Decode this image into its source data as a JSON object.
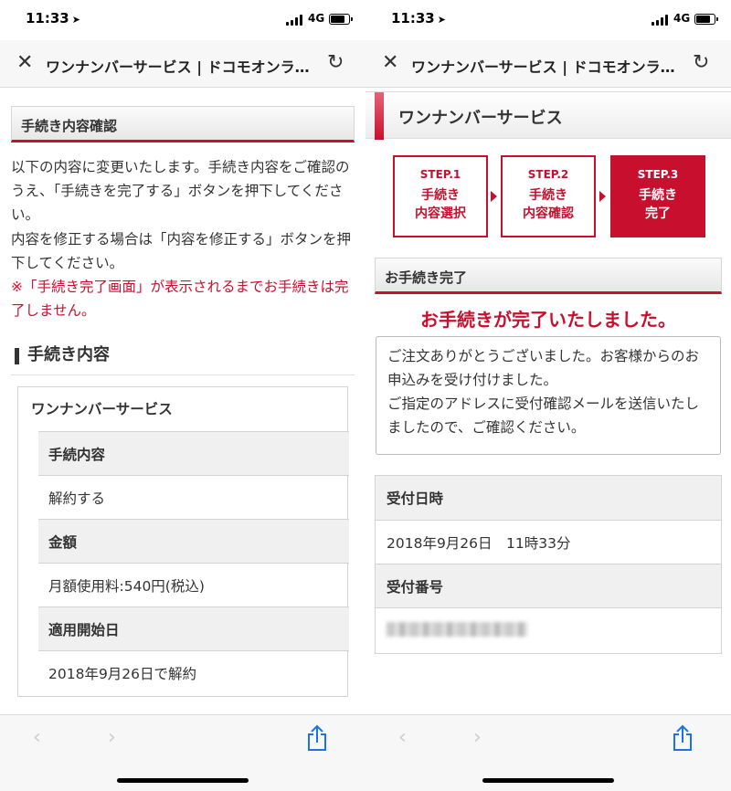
{
  "status_bar": {
    "time": "11:33",
    "location_arrow": "location-arrow-icon",
    "network": "4G"
  },
  "browser": {
    "page_title": "ワンナンバーサービス | ドコモオンラ…"
  },
  "left": {
    "section_header": "手続き内容確認",
    "intro_1": "以下の内容に変更いたします。手続き内容をご確認のうえ、「手続きを完了する」ボタンを押下してください。",
    "intro_2": "内容を修正する場合は「内容を修正する」ボタンを押下してください。",
    "warning": "※「手続き完了画面」が表示されるまでお手続きは完了しません。",
    "heading": "手続き内容",
    "card_title": "ワンナンバーサービス",
    "rows": [
      {
        "label": "手続内容",
        "value": "解約する"
      },
      {
        "label": "金額",
        "value": "月額使用料:540円(税込)"
      },
      {
        "label": "適用開始日",
        "value": "2018年9月26日で解約"
      }
    ]
  },
  "right": {
    "page_title": "ワンナンバーサービス",
    "steps": [
      {
        "no": "STEP.1",
        "line1": "手続き",
        "line2": "内容選択",
        "active": false
      },
      {
        "no": "STEP.2",
        "line1": "手続き",
        "line2": "内容確認",
        "active": false
      },
      {
        "no": "STEP.3",
        "line1": "手続き",
        "line2": "完了",
        "active": true
      }
    ],
    "section_header": "お手続き完了",
    "done_message": "お手続きが完了いたしました。",
    "message_1": "ご注文ありがとうございました。お客様からのお申込みを受け付けました。",
    "message_2": "ご指定のアドレスに受付確認メールを送信いたしましたので、ご確認ください。",
    "table": [
      {
        "label": "受付日時",
        "value": "2018年9月26日　11時33分"
      },
      {
        "label": "受付番号",
        "value": ""
      }
    ]
  },
  "colors": {
    "accent": "#c8102e",
    "label_bg": "#f0f0f0",
    "border": "#d3d3d3"
  }
}
